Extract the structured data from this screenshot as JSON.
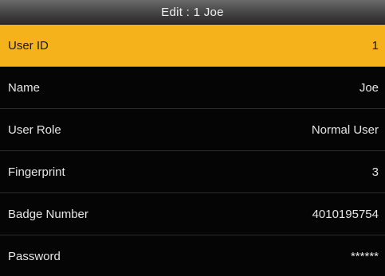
{
  "header": {
    "title": "Edit : 1 Joe"
  },
  "fields": [
    {
      "label": "User ID",
      "value": "1"
    },
    {
      "label": "Name",
      "value": "Joe"
    },
    {
      "label": "User Role",
      "value": "Normal User"
    },
    {
      "label": "Fingerprint",
      "value": "3"
    },
    {
      "label": "Badge Number",
      "value": "4010195754"
    },
    {
      "label": "Password",
      "value": "******"
    }
  ],
  "selected_index": 0,
  "colors": {
    "selection": "#f6b21b",
    "background": "#000000",
    "text": "#e6e6e6"
  }
}
